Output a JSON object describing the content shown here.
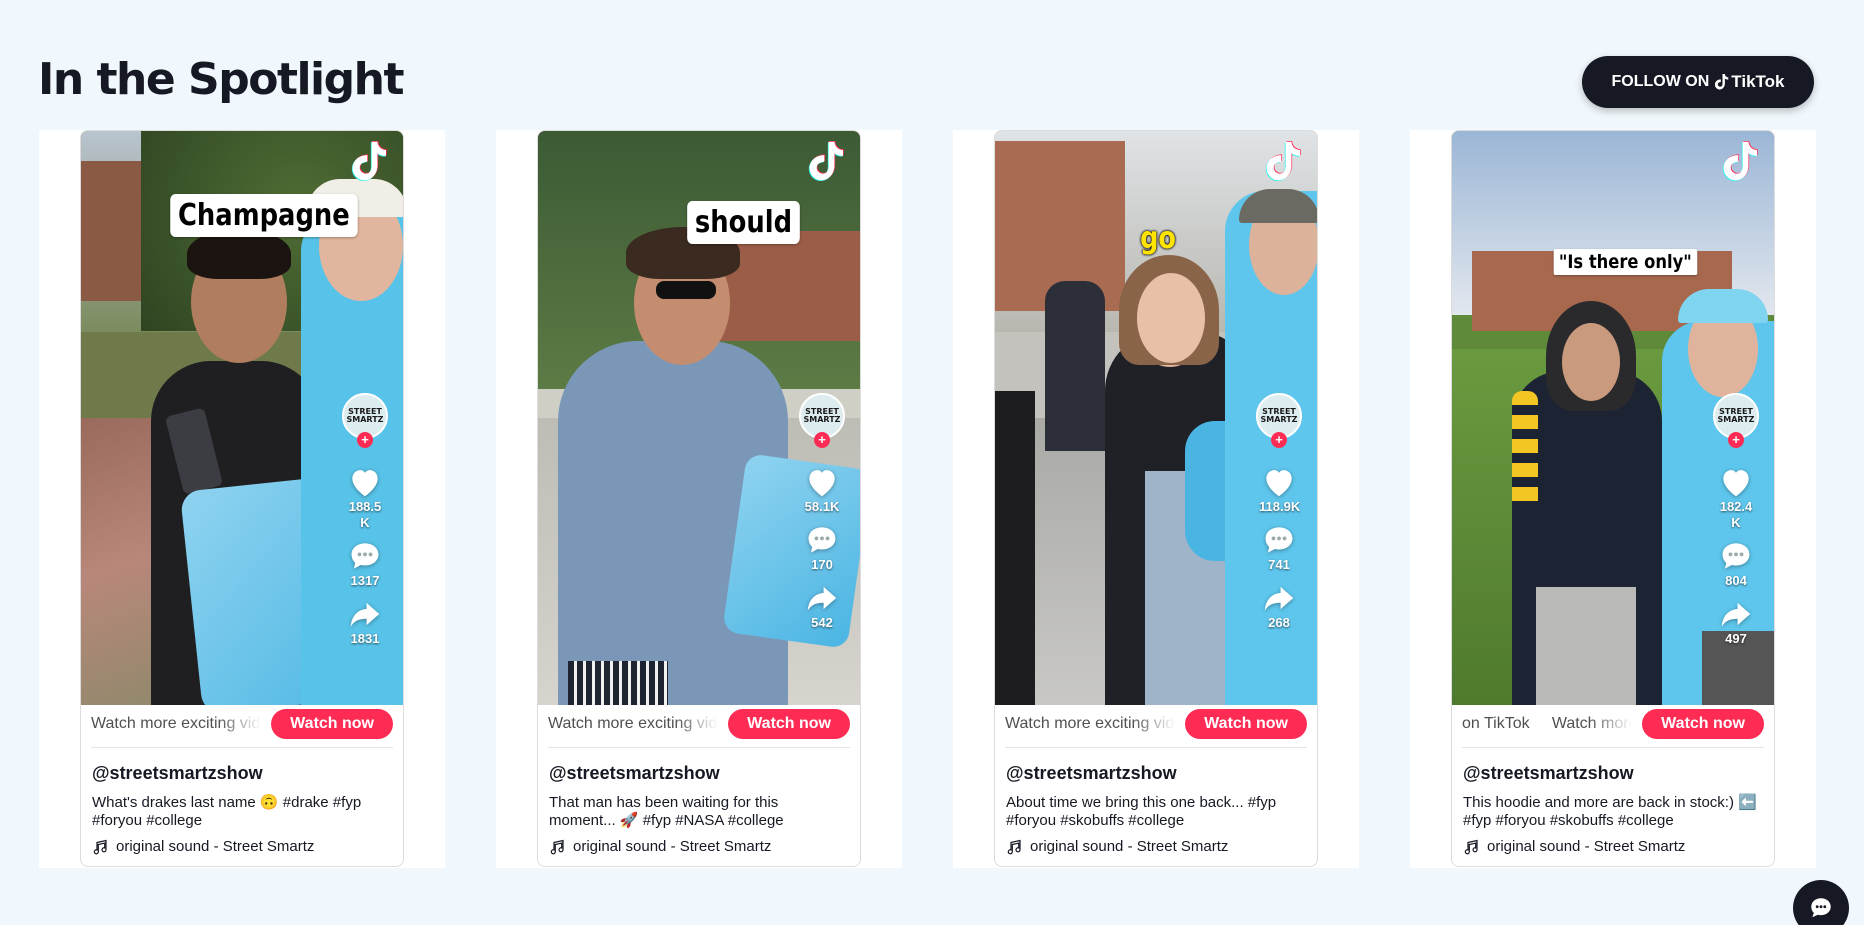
{
  "section": {
    "title": "In the Spotlight",
    "follow_prefix": "FOLLOW ON",
    "follow_brand": "TikTok"
  },
  "cards": [
    {
      "caption": "Champagne",
      "likes": "188.5 K",
      "comments": "1317",
      "shares": "1831",
      "marquee": "Watch more exciting videos on TikTok",
      "watch_label": "Watch now",
      "username": "@streetsmartzshow",
      "description": "What's drakes last name 🙃 #drake #fyp #foryou #college",
      "sound": "original sound - Street Smartz",
      "avatar_text": "STREET SMARTZ"
    },
    {
      "caption": "should",
      "likes": "58.1K",
      "comments": "170",
      "shares": "542",
      "marquee": "Watch more exciting videos on TikTok",
      "watch_label": "Watch now",
      "username": "@streetsmartzshow",
      "description": "That man has been waiting for this moment... 🚀 #fyp #NASA #college",
      "sound": "original sound - Street Smartz",
      "avatar_text": "STREET SMARTZ"
    },
    {
      "caption": "go",
      "likes": "118.9K",
      "comments": "741",
      "shares": "268",
      "marquee": "Watch more exciting videos on TikTok",
      "watch_label": "Watch now",
      "username": "@streetsmartzshow",
      "description": "About time we bring this one back... #fyp #foryou #skobuffs #college",
      "sound": "original sound - Street Smartz",
      "avatar_text": "STREET SMARTZ"
    },
    {
      "caption": "\"Is there only\"",
      "likes": "182.4 K",
      "comments": "804",
      "shares": "497",
      "marquee": "on TikTok     Watch more",
      "watch_label": "Watch now",
      "username": "@streetsmartzshow",
      "description": "This hoodie and more are back in stock:) ⬅️ #fyp #foryou #skobuffs #college",
      "sound": "original sound - Street Smartz",
      "avatar_text": "STREET SMARTZ"
    }
  ],
  "colors": {
    "page_bg": "#f1f8fd",
    "accent": "#fe2c55",
    "dark": "#161823",
    "tiktok_cyan": "#25f4ee"
  },
  "icons": [
    "tiktok-logo-icon",
    "heart-icon",
    "comment-icon",
    "share-icon",
    "music-note-icon",
    "chat-icon"
  ]
}
